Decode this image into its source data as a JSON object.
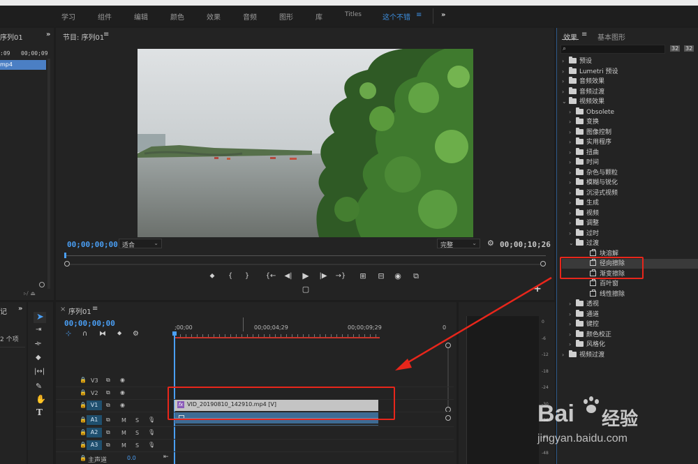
{
  "workspaces": [
    "学习",
    "组件",
    "编辑",
    "颜色",
    "效果",
    "音频",
    "图形",
    "库",
    "Titles",
    "这个不错"
  ],
  "workspace_menu_glyph": "≡",
  "workspace_more": "»",
  "project_panel": {
    "title": "序列01",
    "timecode_start": ":09",
    "timecode_end": "00;00;09",
    "item_label": "mp4"
  },
  "program_monitor": {
    "title": "节目: 序列01",
    "menu_glyph": "≡",
    "timecode_current": "00;00;00;00",
    "fit": "适合",
    "quality": "完整",
    "duration": "00;00;10;26"
  },
  "transport_glyphs": {
    "marker": "⬥",
    "in": "{",
    "out": "}",
    "go_in": "{←",
    "step_back": "◀|",
    "play": "▶",
    "step_fwd": "|▶",
    "go_out": "→}",
    "lift": "⊞",
    "extract": "⊟",
    "camera": "◉",
    "compare": "⧉",
    "multicam": "▢",
    "add": "+",
    "wrench": "🔧"
  },
  "effects_panel": {
    "tab_effects": "效果",
    "tab_graphics": "基本图形",
    "menu_glyph": "≡",
    "search_placeholder": "",
    "icon_new_bin": "32",
    "icon_yuv": "32",
    "items": [
      {
        "label": "预设",
        "level": 0,
        "expanded": false,
        "type": "folder-stack"
      },
      {
        "label": "Lumetri 预设",
        "level": 0,
        "expanded": false,
        "type": "folder-stack"
      },
      {
        "label": "音频效果",
        "level": 0,
        "expanded": false,
        "type": "folder"
      },
      {
        "label": "音频过渡",
        "level": 0,
        "expanded": false,
        "type": "folder"
      },
      {
        "label": "视频效果",
        "level": 0,
        "expanded": true,
        "type": "folder"
      },
      {
        "label": "Obsolete",
        "level": 1,
        "expanded": false,
        "type": "folder"
      },
      {
        "label": "变换",
        "level": 1,
        "expanded": false,
        "type": "folder"
      },
      {
        "label": "图像控制",
        "level": 1,
        "expanded": false,
        "type": "folder"
      },
      {
        "label": "实用程序",
        "level": 1,
        "expanded": false,
        "type": "folder"
      },
      {
        "label": "扭曲",
        "level": 1,
        "expanded": false,
        "type": "folder"
      },
      {
        "label": "时间",
        "level": 1,
        "expanded": false,
        "type": "folder"
      },
      {
        "label": "杂色与颗粒",
        "level": 1,
        "expanded": false,
        "type": "folder"
      },
      {
        "label": "模糊与锐化",
        "level": 1,
        "expanded": false,
        "type": "folder"
      },
      {
        "label": "沉浸式视频",
        "level": 1,
        "expanded": false,
        "type": "folder"
      },
      {
        "label": "生成",
        "level": 1,
        "expanded": false,
        "type": "folder"
      },
      {
        "label": "视频",
        "level": 1,
        "expanded": false,
        "type": "folder"
      },
      {
        "label": "调整",
        "level": 1,
        "expanded": false,
        "type": "folder"
      },
      {
        "label": "过时",
        "level": 1,
        "expanded": false,
        "type": "folder"
      },
      {
        "label": "过渡",
        "level": 1,
        "expanded": true,
        "type": "folder"
      },
      {
        "label": "块溶解",
        "level": 2,
        "type": "effect"
      },
      {
        "label": "径向擦除",
        "level": 2,
        "type": "effect",
        "selected": true
      },
      {
        "label": "渐变擦除",
        "level": 2,
        "type": "effect"
      },
      {
        "label": "百叶窗",
        "level": 2,
        "type": "effect"
      },
      {
        "label": "线性擦除",
        "level": 2,
        "type": "effect"
      },
      {
        "label": "透视",
        "level": 1,
        "expanded": false,
        "type": "folder"
      },
      {
        "label": "通道",
        "level": 1,
        "expanded": false,
        "type": "folder"
      },
      {
        "label": "键控",
        "level": 1,
        "expanded": false,
        "type": "folder"
      },
      {
        "label": "颜色校正",
        "level": 1,
        "expanded": false,
        "type": "folder"
      },
      {
        "label": "风格化",
        "level": 1,
        "expanded": false,
        "type": "folder"
      },
      {
        "label": "视频过渡",
        "level": 0,
        "expanded": false,
        "type": "folder"
      }
    ]
  },
  "left_tools_panel": {
    "title": "记",
    "more": "»",
    "count_label": "2 个项"
  },
  "timeline": {
    "title": "序列01",
    "close": "×",
    "menu_glyph": "≡",
    "timecode": "00;00;00;00",
    "ruler": [
      ";00;00",
      "00;00;04;29",
      "00;00;09;29",
      "0"
    ],
    "tracks": [
      {
        "name": "V3",
        "type": "video",
        "target": false
      },
      {
        "name": "V2",
        "type": "video",
        "target": false
      },
      {
        "name": "V1",
        "type": "video",
        "target": true
      },
      {
        "name": "A1",
        "type": "audio",
        "target": true
      },
      {
        "name": "A2",
        "type": "audio",
        "target": true
      },
      {
        "name": "A3",
        "type": "audio",
        "target": true
      }
    ],
    "master": {
      "label": "主声道",
      "value": "0.0"
    },
    "clip_label": "VID_20190810_142910.mp4 [V]",
    "fx_badge": "fx",
    "mute": "M",
    "solo": "S"
  },
  "audio_meter_ticks": [
    "0",
    "-6",
    "-12",
    "-18",
    "-24",
    "-30",
    "-36",
    "-42",
    "-48"
  ],
  "watermark": {
    "brand": "Bai",
    "brand2": "经验",
    "url": "jingyan.baidu.com"
  },
  "colors": {
    "accent": "#3d8fe0",
    "annotation": "#e8261b",
    "clip": "#c4c4c4",
    "track_target": "#1f4f6e"
  }
}
